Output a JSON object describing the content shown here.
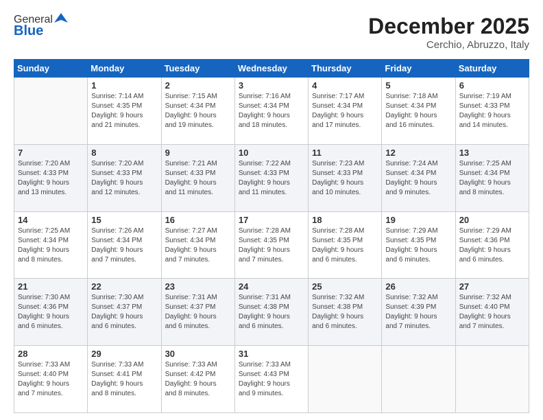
{
  "header": {
    "logo_general": "General",
    "logo_blue": "Blue",
    "month": "December 2025",
    "location": "Cerchio, Abruzzo, Italy"
  },
  "weekdays": [
    "Sunday",
    "Monday",
    "Tuesday",
    "Wednesday",
    "Thursday",
    "Friday",
    "Saturday"
  ],
  "weeks": [
    [
      {
        "day": "",
        "info": ""
      },
      {
        "day": "1",
        "info": "Sunrise: 7:14 AM\nSunset: 4:35 PM\nDaylight: 9 hours\nand 21 minutes."
      },
      {
        "day": "2",
        "info": "Sunrise: 7:15 AM\nSunset: 4:34 PM\nDaylight: 9 hours\nand 19 minutes."
      },
      {
        "day": "3",
        "info": "Sunrise: 7:16 AM\nSunset: 4:34 PM\nDaylight: 9 hours\nand 18 minutes."
      },
      {
        "day": "4",
        "info": "Sunrise: 7:17 AM\nSunset: 4:34 PM\nDaylight: 9 hours\nand 17 minutes."
      },
      {
        "day": "5",
        "info": "Sunrise: 7:18 AM\nSunset: 4:34 PM\nDaylight: 9 hours\nand 16 minutes."
      },
      {
        "day": "6",
        "info": "Sunrise: 7:19 AM\nSunset: 4:33 PM\nDaylight: 9 hours\nand 14 minutes."
      }
    ],
    [
      {
        "day": "7",
        "info": "Sunrise: 7:20 AM\nSunset: 4:33 PM\nDaylight: 9 hours\nand 13 minutes."
      },
      {
        "day": "8",
        "info": "Sunrise: 7:20 AM\nSunset: 4:33 PM\nDaylight: 9 hours\nand 12 minutes."
      },
      {
        "day": "9",
        "info": "Sunrise: 7:21 AM\nSunset: 4:33 PM\nDaylight: 9 hours\nand 11 minutes."
      },
      {
        "day": "10",
        "info": "Sunrise: 7:22 AM\nSunset: 4:33 PM\nDaylight: 9 hours\nand 11 minutes."
      },
      {
        "day": "11",
        "info": "Sunrise: 7:23 AM\nSunset: 4:33 PM\nDaylight: 9 hours\nand 10 minutes."
      },
      {
        "day": "12",
        "info": "Sunrise: 7:24 AM\nSunset: 4:34 PM\nDaylight: 9 hours\nand 9 minutes."
      },
      {
        "day": "13",
        "info": "Sunrise: 7:25 AM\nSunset: 4:34 PM\nDaylight: 9 hours\nand 8 minutes."
      }
    ],
    [
      {
        "day": "14",
        "info": "Sunrise: 7:25 AM\nSunset: 4:34 PM\nDaylight: 9 hours\nand 8 minutes."
      },
      {
        "day": "15",
        "info": "Sunrise: 7:26 AM\nSunset: 4:34 PM\nDaylight: 9 hours\nand 7 minutes."
      },
      {
        "day": "16",
        "info": "Sunrise: 7:27 AM\nSunset: 4:34 PM\nDaylight: 9 hours\nand 7 minutes."
      },
      {
        "day": "17",
        "info": "Sunrise: 7:28 AM\nSunset: 4:35 PM\nDaylight: 9 hours\nand 7 minutes."
      },
      {
        "day": "18",
        "info": "Sunrise: 7:28 AM\nSunset: 4:35 PM\nDaylight: 9 hours\nand 6 minutes."
      },
      {
        "day": "19",
        "info": "Sunrise: 7:29 AM\nSunset: 4:35 PM\nDaylight: 9 hours\nand 6 minutes."
      },
      {
        "day": "20",
        "info": "Sunrise: 7:29 AM\nSunset: 4:36 PM\nDaylight: 9 hours\nand 6 minutes."
      }
    ],
    [
      {
        "day": "21",
        "info": "Sunrise: 7:30 AM\nSunset: 4:36 PM\nDaylight: 9 hours\nand 6 minutes."
      },
      {
        "day": "22",
        "info": "Sunrise: 7:30 AM\nSunset: 4:37 PM\nDaylight: 9 hours\nand 6 minutes."
      },
      {
        "day": "23",
        "info": "Sunrise: 7:31 AM\nSunset: 4:37 PM\nDaylight: 9 hours\nand 6 minutes."
      },
      {
        "day": "24",
        "info": "Sunrise: 7:31 AM\nSunset: 4:38 PM\nDaylight: 9 hours\nand 6 minutes."
      },
      {
        "day": "25",
        "info": "Sunrise: 7:32 AM\nSunset: 4:38 PM\nDaylight: 9 hours\nand 6 minutes."
      },
      {
        "day": "26",
        "info": "Sunrise: 7:32 AM\nSunset: 4:39 PM\nDaylight: 9 hours\nand 7 minutes."
      },
      {
        "day": "27",
        "info": "Sunrise: 7:32 AM\nSunset: 4:40 PM\nDaylight: 9 hours\nand 7 minutes."
      }
    ],
    [
      {
        "day": "28",
        "info": "Sunrise: 7:33 AM\nSunset: 4:40 PM\nDaylight: 9 hours\nand 7 minutes."
      },
      {
        "day": "29",
        "info": "Sunrise: 7:33 AM\nSunset: 4:41 PM\nDaylight: 9 hours\nand 8 minutes."
      },
      {
        "day": "30",
        "info": "Sunrise: 7:33 AM\nSunset: 4:42 PM\nDaylight: 9 hours\nand 8 minutes."
      },
      {
        "day": "31",
        "info": "Sunrise: 7:33 AM\nSunset: 4:43 PM\nDaylight: 9 hours\nand 9 minutes."
      },
      {
        "day": "",
        "info": ""
      },
      {
        "day": "",
        "info": ""
      },
      {
        "day": "",
        "info": ""
      }
    ]
  ]
}
